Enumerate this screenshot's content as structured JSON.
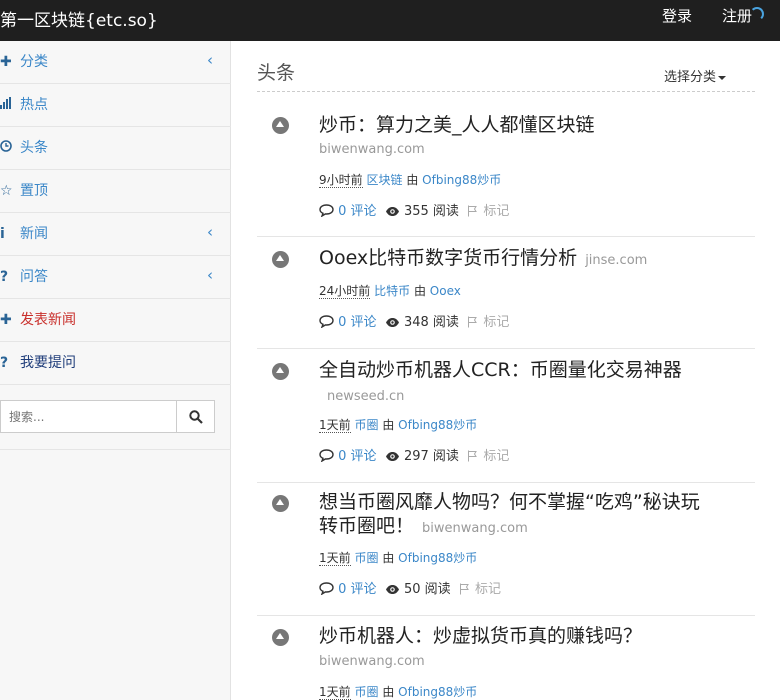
{
  "header": {
    "brand": "第一区块链{etc.so}",
    "login": "登录",
    "register": "注册"
  },
  "sidebar": {
    "items": [
      {
        "icon": "plus-icon",
        "label": "分类",
        "has_chevron": true
      },
      {
        "icon": "bar-chart-icon",
        "label": "热点",
        "has_chevron": false
      },
      {
        "icon": "clock-icon",
        "label": "头条",
        "has_chevron": false
      },
      {
        "icon": "star-icon",
        "label": "置顶",
        "has_chevron": false
      },
      {
        "icon": "info-icon",
        "label": "新闻",
        "has_chevron": true
      },
      {
        "icon": "question-icon",
        "label": "问答",
        "has_chevron": true
      },
      {
        "icon": "plus-icon",
        "label": "发表新闻",
        "has_chevron": false
      },
      {
        "icon": "question-icon",
        "label": "我要提问",
        "has_chevron": false
      }
    ],
    "search_placeholder": "搜索..."
  },
  "main": {
    "title": "头条",
    "select_category": "选择分类",
    "items": [
      {
        "title": "炒币：算力之美_人人都懂区块链",
        "domain": "biwenwang.com",
        "time": "9小时前",
        "category": "区块链",
        "by": "由",
        "author": "Ofbing88炒币",
        "comments": "0 评论",
        "views": "355 阅读",
        "flag": "标记"
      },
      {
        "title": "Ooex比特币数字货币行情分析",
        "domain": "jinse.com",
        "time": "24小时前",
        "category": "比特币",
        "by": "由",
        "author": "Ooex",
        "comments": "0 评论",
        "views": "348 阅读",
        "flag": "标记"
      },
      {
        "title": "全自动炒币机器人CCR：币圈量化交易神器",
        "domain": "newseed.cn",
        "time": "1天前",
        "category": "币圈",
        "by": "由",
        "author": "Ofbing88炒币",
        "comments": "0 评论",
        "views": "297 阅读",
        "flag": "标记"
      },
      {
        "title": "想当币圈风靡人物吗？何不掌握“吃鸡”秘诀玩转币圈吧！",
        "domain": "biwenwang.com",
        "time": "1天前",
        "category": "币圈",
        "by": "由",
        "author": "Ofbing88炒币",
        "comments": "0 评论",
        "views": "50 阅读",
        "flag": "标记"
      },
      {
        "title": "炒币机器人：炒虚拟货币真的赚钱吗？",
        "domain": "biwenwang.com",
        "time": "1天前",
        "category": "币圈",
        "by": "由",
        "author": "Ofbing88炒币"
      }
    ]
  }
}
